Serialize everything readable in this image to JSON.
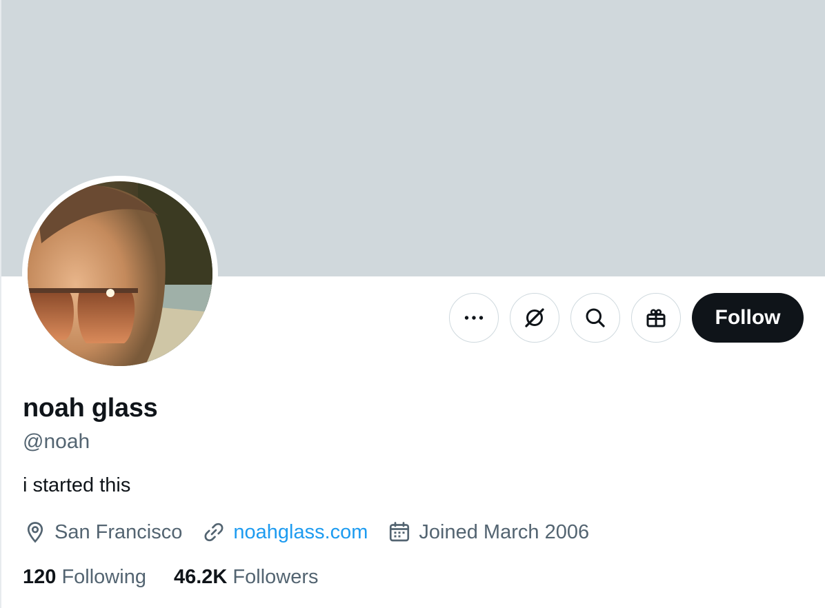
{
  "profile": {
    "name": "noah glass",
    "handle": "@noah",
    "bio": "i started this",
    "location": "San Francisco",
    "website": "noahglass.com",
    "joined": "Joined March 2006"
  },
  "actions": {
    "more_icon": "more-horizontal-icon",
    "grok_icon": "grok-icon",
    "search_icon": "search-icon",
    "gift_icon": "gift-icon",
    "follow_label": "Follow"
  },
  "stats": {
    "following_count": "120",
    "following_label": "Following",
    "followers_count": "46.2K",
    "followers_label": "Followers"
  },
  "colors": {
    "banner": "#d0d8dc",
    "primary_text": "#0f1419",
    "secondary_text": "#536471",
    "link": "#1d9bf0",
    "follow_button": "#0f1419"
  }
}
